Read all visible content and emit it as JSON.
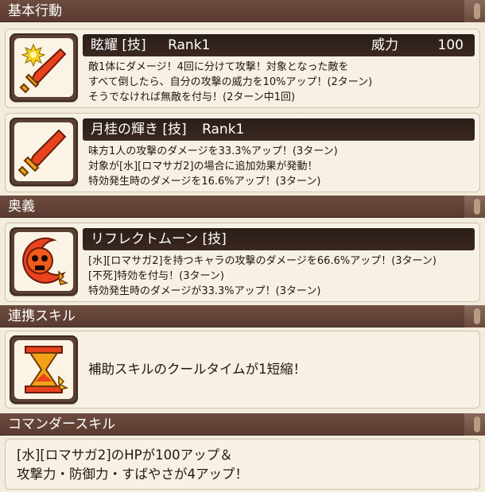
{
  "sections": {
    "basic": "基本行動",
    "ougi": "奥義",
    "renkei": "連携スキル",
    "commander": "コマンダースキル"
  },
  "skill1": {
    "name": "眩耀 [技]",
    "rank": "Rank1",
    "power_label": "威力",
    "power_value": "100",
    "lines": [
      "敵1体にダメージ！4回に分けて攻撃！対象となった敵を",
      "すべて倒したら、自分の攻撃の威力を10%アップ！(2ターン)",
      "そうでなければ無敵を付与！(2ターン中1回)"
    ]
  },
  "skill2": {
    "name": "月桂の輝き [技]",
    "rank": "Rank1",
    "lines": [
      "味方1人の攻撃のダメージを33.3%アップ！(3ターン)",
      "対象が[水][ロマサガ2]の場合に追加効果が発動！",
      "特効発生時のダメージを16.6%アップ！(3ターン)"
    ]
  },
  "ougi": {
    "name": "リフレクトムーン [技]",
    "lines": [
      "[水][ロマサガ2]を持つキャラの攻撃のダメージを66.6%アップ！(3ターン)",
      "[不死]特効を付与！(3ターン)",
      "特効発生時のダメージが33.3%アップ！(3ターン)"
    ]
  },
  "renkei": {
    "line": "補助スキルのクールタイムが1短縮！"
  },
  "commander": {
    "lines": [
      "[水][ロマサガ2]のHPが100アップ＆",
      "攻撃力・防御力・すばやさが4アップ！"
    ]
  },
  "colors": {
    "header_bg": "#5a3b30",
    "title_bar_bg": "#2a1d18",
    "card_bg": "#f6f1e4",
    "icon_accent": "#e8421f"
  }
}
